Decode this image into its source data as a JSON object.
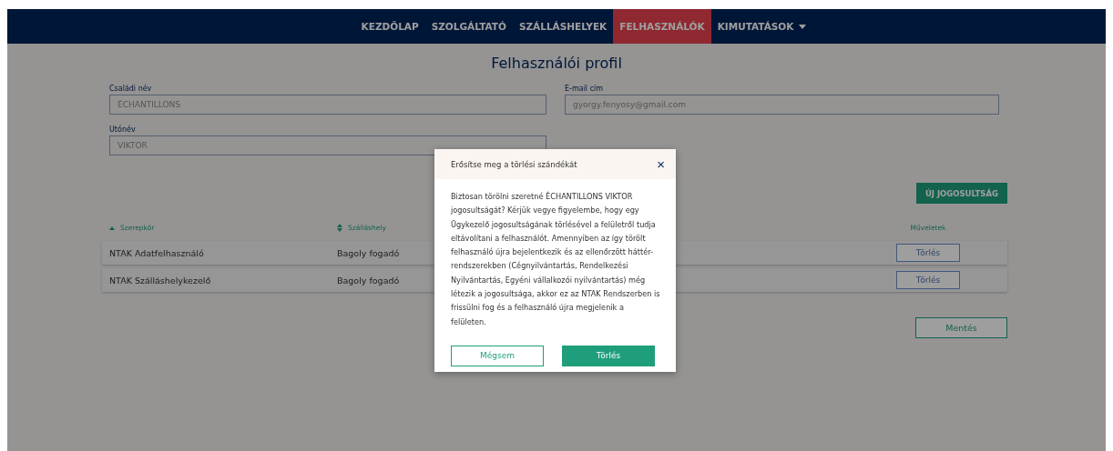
{
  "nav": [
    {
      "label": "KEZDŐLAP",
      "selected": false,
      "dropdown": false
    },
    {
      "label": "SZOLGÁLTATÓ",
      "selected": false,
      "dropdown": false
    },
    {
      "label": "SZÁLLÁSHELYEK",
      "selected": false,
      "dropdown": false
    },
    {
      "label": "FELHASZNÁLÓK",
      "selected": true,
      "dropdown": false
    },
    {
      "label": "KIMUTATÁSOK",
      "selected": false,
      "dropdown": true
    }
  ],
  "page_title": "Felhasználói profil",
  "fields": [
    {
      "label": "Családi név",
      "value": "ÉCHANTILLONS"
    },
    {
      "label": "E-mail cím",
      "value": "gyorgy.fenyosy@gmail.com"
    },
    {
      "label": "Utónév",
      "value": "VIKTOR"
    }
  ],
  "new_button": "ÚJ JOGOSULTSÁG",
  "table": {
    "columns": [
      {
        "label": "Szerepkör",
        "kind": "sorted"
      },
      {
        "label": "Szálláshely",
        "kind": "sortable"
      },
      {
        "label": "Műveletek",
        "kind": "plain"
      }
    ],
    "rows": [
      {
        "role": "NTAK Adatfelhasználó",
        "place": "Bagoly fogadó",
        "action": "Törlés"
      },
      {
        "role": "NTAK Szálláshelykezelő",
        "place": "Bagoly fogadó",
        "action": "Törlés"
      }
    ]
  },
  "save_button": "Mentés",
  "dialog": {
    "title": "Erősítse meg a törlési szándékát",
    "close": "×",
    "message": "Biztosan törölni szeretné ÉCHANTILLONS VIKTOR jogosultságát? Kérjük vegye figyelembe, hogy egy Ügykezelő jogosultságának törlésével a felületről tudja eltávolítani a felhasználót. Amennyiben az így törölt felhasználó újra bejelentkezik és az ellenőrzött háttér-rendszerekben (Cégnyilvántartás, Rendelkezési Nyilvántartás, Egyéni vállalkozói nyilvántartás) még létezik a jogosultsága, akkor ez az NTAK Rendszerben is frissülni fog és a felhasználó újra megjelenik a felületen.",
    "cancel": "Mégsem",
    "confirm": "Törlés"
  }
}
